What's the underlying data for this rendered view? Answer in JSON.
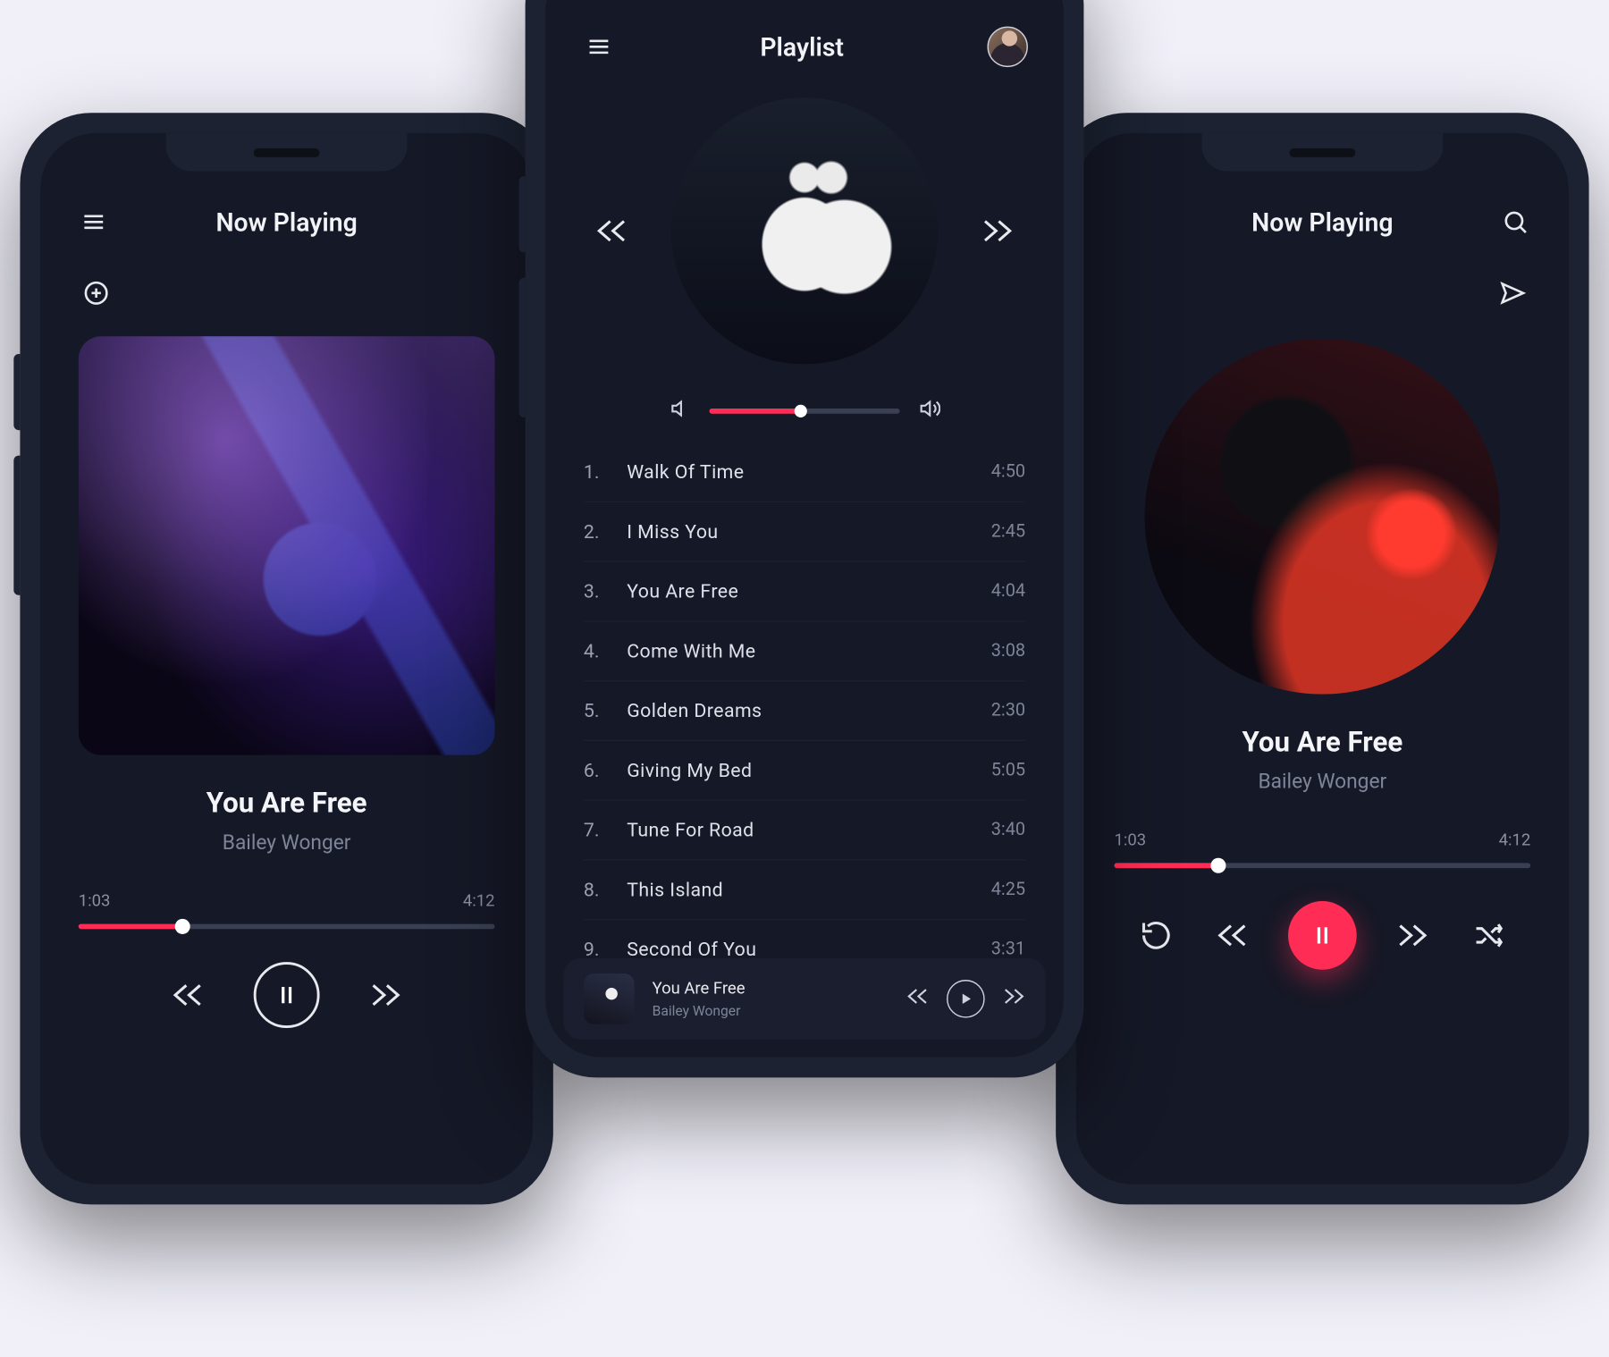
{
  "colors": {
    "accent": "#ff2d55",
    "bg": "#151826",
    "device": "#1c2232",
    "muted": "#7e8599"
  },
  "left": {
    "header": "Now Playing",
    "track_title": "You Are Free",
    "track_artist": "Bailey Wonger",
    "time_current": "1:03",
    "time_total": "4:12",
    "progress_pct": 25
  },
  "right": {
    "header": "Now Playing",
    "track_title": "You Are Free",
    "track_artist": "Bailey Wonger",
    "time_current": "1:03",
    "time_total": "4:12",
    "progress_pct": 25
  },
  "center": {
    "header": "Playlist",
    "volume_pct": 48,
    "tracks": [
      {
        "n": "1.",
        "name": "Walk Of Time",
        "dur": "4:50"
      },
      {
        "n": "2.",
        "name": "I Miss You",
        "dur": "2:45"
      },
      {
        "n": "3.",
        "name": "You Are Free",
        "dur": "4:04"
      },
      {
        "n": "4.",
        "name": "Come With Me",
        "dur": "3:08"
      },
      {
        "n": "5.",
        "name": "Golden Dreams",
        "dur": "2:30"
      },
      {
        "n": "6.",
        "name": "Giving My Bed",
        "dur": "5:05"
      },
      {
        "n": "7.",
        "name": "Tune For Road",
        "dur": "3:40"
      },
      {
        "n": "8.",
        "name": "This Island",
        "dur": "4:25"
      },
      {
        "n": "9.",
        "name": "Second Of You",
        "dur": "3:31"
      }
    ],
    "mini": {
      "title": "You Are Free",
      "artist": "Bailey Wonger"
    }
  }
}
